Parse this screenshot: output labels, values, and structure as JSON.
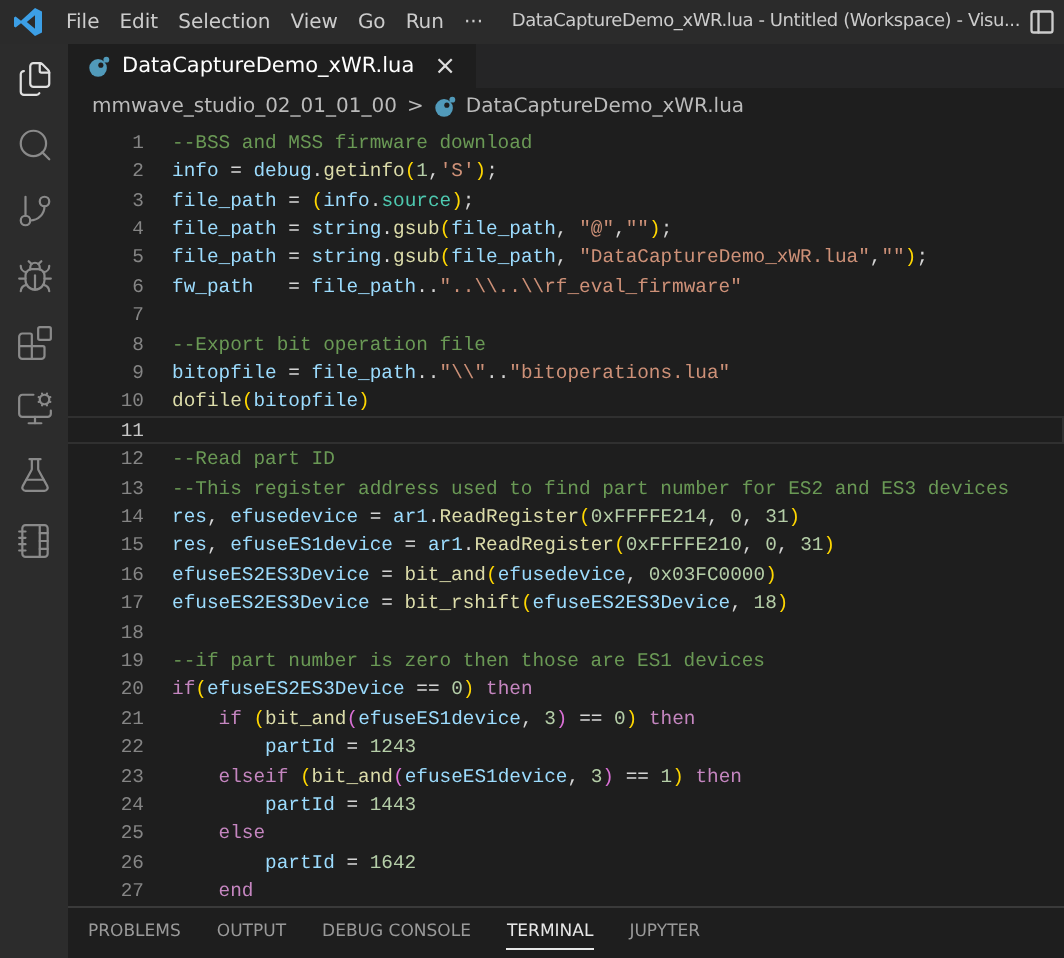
{
  "title_bar": {
    "menu": [
      "File",
      "Edit",
      "Selection",
      "View",
      "Go",
      "Run",
      "···"
    ],
    "title": "DataCaptureDemo_xWR.lua - Untitled (Workspace) - Visu..."
  },
  "activity_bar": {
    "items": [
      {
        "kind": "files",
        "selected": true
      },
      {
        "kind": "search",
        "selected": false
      },
      {
        "kind": "git",
        "selected": false
      },
      {
        "kind": "debug",
        "selected": false
      },
      {
        "kind": "extensions",
        "selected": false
      },
      {
        "kind": "remote",
        "selected": false
      },
      {
        "kind": "testing",
        "selected": false
      },
      {
        "kind": "notebook",
        "selected": false
      }
    ]
  },
  "tabs": [
    {
      "label": "DataCaptureDemo_xWR.lua",
      "close": "×",
      "selected": true
    }
  ],
  "breadcrumb": {
    "folder": "mmwave_studio_02_01_01_00",
    "separator": ">",
    "file": "DataCaptureDemo_xWR.lua"
  },
  "editor": {
    "lines": [
      {
        "number": "1",
        "current": false,
        "tokens": [
          {
            "kind": "c",
            "text": "--BSS and MSS firmware download"
          }
        ]
      },
      {
        "number": "2",
        "current": false,
        "tokens": [
          {
            "kind": "v",
            "text": "info"
          },
          {
            "kind": "p",
            "text": " = "
          },
          {
            "kind": "v",
            "text": "debug"
          },
          {
            "kind": "p",
            "text": "."
          },
          {
            "kind": "f",
            "text": "getinfo"
          },
          {
            "kind": "b",
            "text": "("
          },
          {
            "kind": "n",
            "text": "1"
          },
          {
            "kind": "p",
            "text": ","
          },
          {
            "kind": "s",
            "text": "'S'"
          },
          {
            "kind": "b",
            "text": ")"
          },
          {
            "kind": "p",
            "text": ";"
          }
        ]
      },
      {
        "number": "3",
        "current": false,
        "tokens": [
          {
            "kind": "v",
            "text": "file_path"
          },
          {
            "kind": "p",
            "text": " = "
          },
          {
            "kind": "b",
            "text": "("
          },
          {
            "kind": "v",
            "text": "info"
          },
          {
            "kind": "p",
            "text": "."
          },
          {
            "kind": "t",
            "text": "source"
          },
          {
            "kind": "b",
            "text": ")"
          },
          {
            "kind": "p",
            "text": ";"
          }
        ]
      },
      {
        "number": "4",
        "current": false,
        "tokens": [
          {
            "kind": "v",
            "text": "file_path"
          },
          {
            "kind": "p",
            "text": " = "
          },
          {
            "kind": "v",
            "text": "string"
          },
          {
            "kind": "p",
            "text": "."
          },
          {
            "kind": "f",
            "text": "gsub"
          },
          {
            "kind": "b",
            "text": "("
          },
          {
            "kind": "v",
            "text": "file_path"
          },
          {
            "kind": "p",
            "text": ", "
          },
          {
            "kind": "s",
            "text": "\"@\""
          },
          {
            "kind": "p",
            "text": ","
          },
          {
            "kind": "s",
            "text": "\"\""
          },
          {
            "kind": "b",
            "text": ")"
          },
          {
            "kind": "p",
            "text": ";"
          }
        ]
      },
      {
        "number": "5",
        "current": false,
        "tokens": [
          {
            "kind": "v",
            "text": "file_path"
          },
          {
            "kind": "p",
            "text": " = "
          },
          {
            "kind": "v",
            "text": "string"
          },
          {
            "kind": "p",
            "text": "."
          },
          {
            "kind": "f",
            "text": "gsub"
          },
          {
            "kind": "b",
            "text": "("
          },
          {
            "kind": "v",
            "text": "file_path"
          },
          {
            "kind": "p",
            "text": ", "
          },
          {
            "kind": "s",
            "text": "\"DataCaptureDemo_xWR.lua\""
          },
          {
            "kind": "p",
            "text": ","
          },
          {
            "kind": "s",
            "text": "\"\""
          },
          {
            "kind": "b",
            "text": ")"
          },
          {
            "kind": "p",
            "text": ";"
          }
        ]
      },
      {
        "number": "6",
        "current": false,
        "tokens": [
          {
            "kind": "v",
            "text": "fw_path"
          },
          {
            "kind": "p",
            "text": "   = "
          },
          {
            "kind": "v",
            "text": "file_path"
          },
          {
            "kind": "p",
            "text": ".."
          },
          {
            "kind": "s",
            "text": "\"..\\\\..\\\\rf_eval_firmware\""
          }
        ]
      },
      {
        "number": "7",
        "current": false
      },
      {
        "number": "8",
        "current": false,
        "tokens": [
          {
            "kind": "c",
            "text": "--Export bit operation file"
          }
        ]
      },
      {
        "number": "9",
        "current": false,
        "tokens": [
          {
            "kind": "v",
            "text": "bitopfile"
          },
          {
            "kind": "p",
            "text": " = "
          },
          {
            "kind": "v",
            "text": "file_path"
          },
          {
            "kind": "p",
            "text": ".."
          },
          {
            "kind": "s",
            "text": "\"\\\\\""
          },
          {
            "kind": "p",
            "text": ".."
          },
          {
            "kind": "s",
            "text": "\"bitoperations.lua\""
          }
        ]
      },
      {
        "number": "10",
        "current": false,
        "tokens": [
          {
            "kind": "f",
            "text": "dofile"
          },
          {
            "kind": "b",
            "text": "("
          },
          {
            "kind": "v",
            "text": "bitopfile"
          },
          {
            "kind": "b",
            "text": ")"
          }
        ]
      },
      {
        "number": "11",
        "current": true
      },
      {
        "number": "12",
        "current": false,
        "tokens": [
          {
            "kind": "c",
            "text": "--Read part ID"
          }
        ]
      },
      {
        "number": "13",
        "current": false,
        "tokens": [
          {
            "kind": "c",
            "text": "--This register address used to find part number for ES2 and ES3 devices"
          }
        ]
      },
      {
        "number": "14",
        "current": false,
        "tokens": [
          {
            "kind": "v",
            "text": "res"
          },
          {
            "kind": "p",
            "text": ", "
          },
          {
            "kind": "v",
            "text": "efusedevice"
          },
          {
            "kind": "p",
            "text": " = "
          },
          {
            "kind": "v",
            "text": "ar1"
          },
          {
            "kind": "p",
            "text": "."
          },
          {
            "kind": "f",
            "text": "ReadRegister"
          },
          {
            "kind": "b",
            "text": "("
          },
          {
            "kind": "n",
            "text": "0xFFFFE214"
          },
          {
            "kind": "p",
            "text": ", "
          },
          {
            "kind": "n",
            "text": "0"
          },
          {
            "kind": "p",
            "text": ", "
          },
          {
            "kind": "n",
            "text": "31"
          },
          {
            "kind": "b",
            "text": ")"
          }
        ]
      },
      {
        "number": "15",
        "current": false,
        "tokens": [
          {
            "kind": "v",
            "text": "res"
          },
          {
            "kind": "p",
            "text": ", "
          },
          {
            "kind": "v",
            "text": "efuseES1device"
          },
          {
            "kind": "p",
            "text": " = "
          },
          {
            "kind": "v",
            "text": "ar1"
          },
          {
            "kind": "p",
            "text": "."
          },
          {
            "kind": "f",
            "text": "ReadRegister"
          },
          {
            "kind": "b",
            "text": "("
          },
          {
            "kind": "n",
            "text": "0xFFFFE210"
          },
          {
            "kind": "p",
            "text": ", "
          },
          {
            "kind": "n",
            "text": "0"
          },
          {
            "kind": "p",
            "text": ", "
          },
          {
            "kind": "n",
            "text": "31"
          },
          {
            "kind": "b",
            "text": ")"
          }
        ]
      },
      {
        "number": "16",
        "current": false,
        "tokens": [
          {
            "kind": "v",
            "text": "efuseES2ES3Device"
          },
          {
            "kind": "p",
            "text": " = "
          },
          {
            "kind": "f",
            "text": "bit_and"
          },
          {
            "kind": "b",
            "text": "("
          },
          {
            "kind": "v",
            "text": "efusedevice"
          },
          {
            "kind": "p",
            "text": ", "
          },
          {
            "kind": "n",
            "text": "0x03FC0000"
          },
          {
            "kind": "b",
            "text": ")"
          }
        ]
      },
      {
        "number": "17",
        "current": false,
        "tokens": [
          {
            "kind": "v",
            "text": "efuseES2ES3Device"
          },
          {
            "kind": "p",
            "text": " = "
          },
          {
            "kind": "f",
            "text": "bit_rshift"
          },
          {
            "kind": "b",
            "text": "("
          },
          {
            "kind": "v",
            "text": "efuseES2ES3Device"
          },
          {
            "kind": "p",
            "text": ", "
          },
          {
            "kind": "n",
            "text": "18"
          },
          {
            "kind": "b",
            "text": ")"
          }
        ]
      },
      {
        "number": "18",
        "current": false
      },
      {
        "number": "19",
        "current": false,
        "tokens": [
          {
            "kind": "c",
            "text": "--if part number is zero then those are ES1 devices"
          }
        ]
      },
      {
        "number": "20",
        "current": false,
        "tokens": [
          {
            "kind": "k",
            "text": "if"
          },
          {
            "kind": "b",
            "text": "("
          },
          {
            "kind": "v",
            "text": "efuseES2ES3Device"
          },
          {
            "kind": "p",
            "text": " == "
          },
          {
            "kind": "n",
            "text": "0"
          },
          {
            "kind": "b",
            "text": ")"
          },
          {
            "kind": "k",
            "text": " then"
          }
        ]
      },
      {
        "number": "21",
        "current": false,
        "tokens": [
          {
            "kind": "k",
            "text": "    if"
          },
          {
            "kind": "b",
            "text": " ("
          },
          {
            "kind": "f",
            "text": "bit_and"
          },
          {
            "kind": "m",
            "text": "("
          },
          {
            "kind": "v",
            "text": "efuseES1device"
          },
          {
            "kind": "p",
            "text": ", "
          },
          {
            "kind": "n",
            "text": "3"
          },
          {
            "kind": "m",
            "text": ")"
          },
          {
            "kind": "p",
            "text": " == "
          },
          {
            "kind": "n",
            "text": "0"
          },
          {
            "kind": "b",
            "text": ")"
          },
          {
            "kind": "k",
            "text": " then"
          }
        ]
      },
      {
        "number": "22",
        "current": false,
        "tokens": [
          {
            "kind": "v",
            "text": "        partId"
          },
          {
            "kind": "p",
            "text": " = "
          },
          {
            "kind": "n",
            "text": "1243"
          }
        ]
      },
      {
        "number": "23",
        "current": false,
        "tokens": [
          {
            "kind": "k",
            "text": "    elseif"
          },
          {
            "kind": "b",
            "text": " ("
          },
          {
            "kind": "f",
            "text": "bit_and"
          },
          {
            "kind": "m",
            "text": "("
          },
          {
            "kind": "v",
            "text": "efuseES1device"
          },
          {
            "kind": "p",
            "text": ", "
          },
          {
            "kind": "n",
            "text": "3"
          },
          {
            "kind": "m",
            "text": ")"
          },
          {
            "kind": "p",
            "text": " == "
          },
          {
            "kind": "n",
            "text": "1"
          },
          {
            "kind": "b",
            "text": ")"
          },
          {
            "kind": "k",
            "text": " then"
          }
        ]
      },
      {
        "number": "24",
        "current": false,
        "tokens": [
          {
            "kind": "v",
            "text": "        partId"
          },
          {
            "kind": "p",
            "text": " = "
          },
          {
            "kind": "n",
            "text": "1443"
          }
        ]
      },
      {
        "number": "25",
        "current": false,
        "tokens": [
          {
            "kind": "k",
            "text": "    else"
          }
        ]
      },
      {
        "number": "26",
        "current": false,
        "tokens": [
          {
            "kind": "v",
            "text": "        partId"
          },
          {
            "kind": "p",
            "text": " = "
          },
          {
            "kind": "n",
            "text": "1642"
          }
        ]
      },
      {
        "number": "27",
        "current": false,
        "tokens": [
          {
            "kind": "k",
            "text": "    end"
          }
        ]
      }
    ]
  },
  "panel": {
    "tabs": [
      {
        "label": "PROBLEMS",
        "selected": false
      },
      {
        "label": "OUTPUT",
        "selected": false
      },
      {
        "label": "DEBUG CONSOLE",
        "selected": false
      },
      {
        "label": "TERMINAL",
        "selected": true
      },
      {
        "label": "JUPYTER",
        "selected": false
      }
    ]
  }
}
